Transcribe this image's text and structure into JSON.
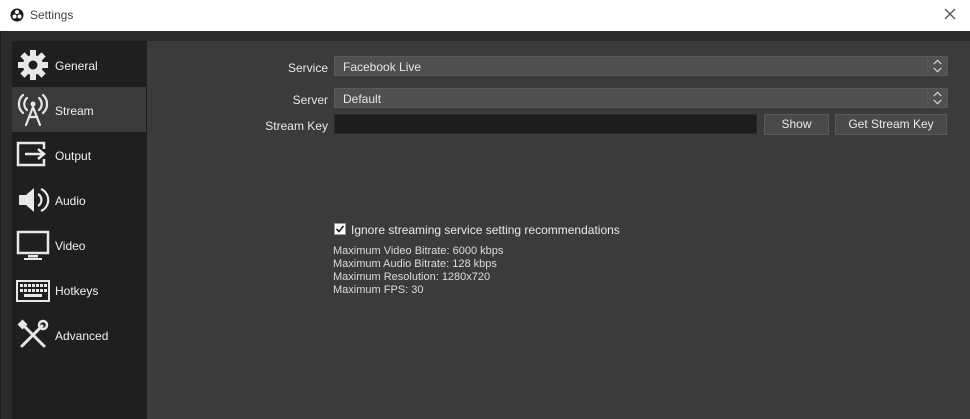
{
  "window": {
    "title": "Settings"
  },
  "sidebar": {
    "items": [
      {
        "label": "General",
        "icon": "gear-icon"
      },
      {
        "label": "Stream",
        "icon": "broadcast-icon",
        "active": true
      },
      {
        "label": "Output",
        "icon": "output-icon"
      },
      {
        "label": "Audio",
        "icon": "speaker-icon"
      },
      {
        "label": "Video",
        "icon": "monitor-icon"
      },
      {
        "label": "Hotkeys",
        "icon": "keyboard-icon"
      },
      {
        "label": "Advanced",
        "icon": "tools-icon"
      }
    ]
  },
  "stream": {
    "service_label": "Service",
    "service_value": "Facebook Live",
    "server_label": "Server",
    "server_value": "Default",
    "key_label": "Stream Key",
    "key_value": "",
    "show_button": "Show",
    "get_key_button": "Get Stream Key",
    "ignore_checkbox_label": "Ignore streaming service setting recommendations",
    "ignore_checked": true,
    "info": {
      "max_video_bitrate": "Maximum Video Bitrate: 6000 kbps",
      "max_audio_bitrate": "Maximum Audio Bitrate: 128 kbps",
      "max_resolution": "Maximum Resolution: 1280x720",
      "max_fps": "Maximum FPS: 30"
    }
  },
  "colors": {
    "sidebar_bg": "#1f1f1f",
    "main_bg": "#3b3b3b",
    "active_item_bg": "#3a3a3a"
  }
}
